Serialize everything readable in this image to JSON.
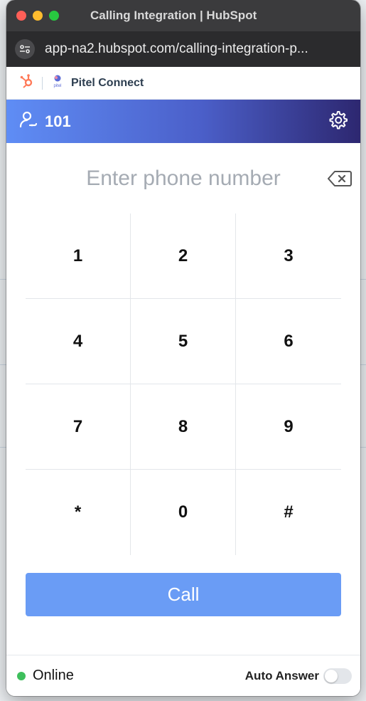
{
  "window": {
    "title": "Calling Integration | HubSpot"
  },
  "browser": {
    "url": "app-na2.hubspot.com/calling-integration-p..."
  },
  "app": {
    "name": "Pitel Connect",
    "logo_text": "pitel"
  },
  "extension": {
    "number": "101"
  },
  "dialer": {
    "placeholder": "Enter phone number",
    "keys": [
      "1",
      "2",
      "3",
      "4",
      "5",
      "6",
      "7",
      "8",
      "9",
      "*",
      "0",
      "#"
    ],
    "call_label": "Call"
  },
  "footer": {
    "status": "Online",
    "auto_answer_label": "Auto Answer",
    "auto_answer_on": false
  },
  "colors": {
    "accent": "#6a9cf5",
    "online": "#3ebf5c",
    "hubspot": "#ff7a59",
    "banner_start": "#5f8df5",
    "banner_end": "#2d2770"
  },
  "icons": [
    "hubspot-logo-icon",
    "pitel-logo-icon",
    "agent-icon",
    "gear-icon",
    "backspace-icon",
    "site-settings-icon"
  ]
}
